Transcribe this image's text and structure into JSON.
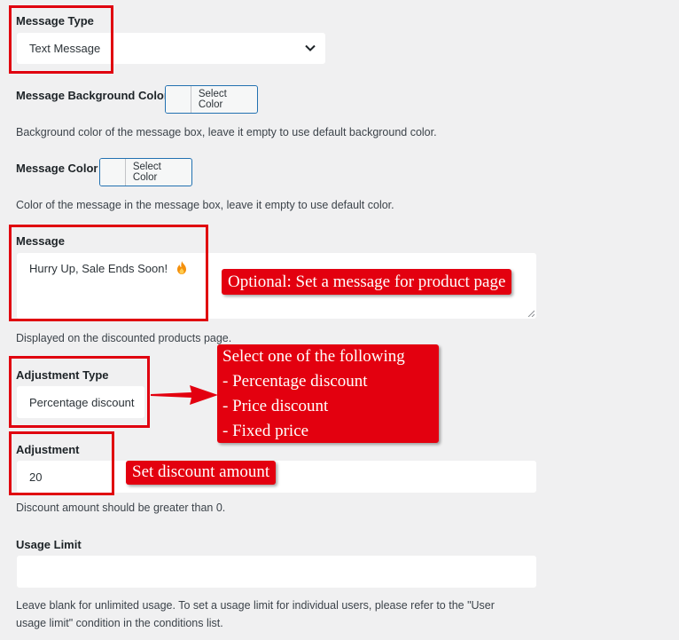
{
  "message_type": {
    "label": "Message Type",
    "value": "Text Message"
  },
  "bg_color": {
    "label": "Message Background Color",
    "button": "Select Color",
    "description": "Background color of the message box, leave it empty to use default background color."
  },
  "msg_color": {
    "label": "Message Color",
    "button": "Select Color",
    "description": "Color of the message in the message box, leave it empty to use default color."
  },
  "message": {
    "label": "Message",
    "value": "Hurry Up, Sale Ends Soon!",
    "description": "Displayed on the discounted products page."
  },
  "adjustment_type": {
    "label": "Adjustment Type",
    "value": "Percentage discount"
  },
  "adjustment": {
    "label": "Adjustment",
    "value": "20",
    "description": "Discount amount should be greater than 0."
  },
  "usage_limit": {
    "label": "Usage Limit",
    "value": "",
    "description_line1": "Leave blank for unlimited usage. To set a usage limit for individual users, please refer to the \"User",
    "description_line2": "usage limit\" condition in the conditions list."
  },
  "annotations": {
    "message_note": "Optional: Set a message for product page",
    "type_lines": [
      "Select one of the following",
      "- Percentage discount",
      "- Price discount",
      "- Fixed price"
    ],
    "amount_note": "Set discount amount"
  },
  "colors": {
    "annotation_red": "#e3000f",
    "accent_blue": "#2271b1"
  },
  "icons": {
    "select_arrow": "chevron-down-icon",
    "message_emoji": "fire-icon"
  }
}
